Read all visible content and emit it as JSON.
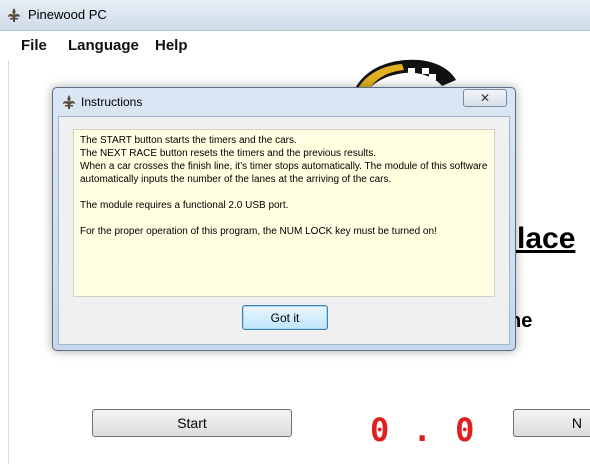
{
  "window": {
    "title": "Pinewood PC",
    "icon": "fleur-de-lis-icon"
  },
  "menu": {
    "items": [
      "File",
      "Language",
      "Help"
    ]
  },
  "main": {
    "place_text": "Place",
    "ne_text": "ne",
    "start_label": "Start",
    "next_label": "N",
    "timer": "0 . 0",
    "timer_color": "#e01f1f"
  },
  "dialog": {
    "title": "Instructions",
    "close_label": "✕",
    "lines": [
      "The START button starts the timers and the cars.",
      "The NEXT RACE button resets the timers and the previous results.",
      "When a car crosses the finish line, it’s timer stops automatically. The module of this software automatically inputs the number of the lanes at the arriving of the cars.",
      "The module requires a functional 2.0 USB port.",
      "For the proper operation of this program, the NUM LOCK key must be turned on!"
    ],
    "button_label": "Got it"
  }
}
